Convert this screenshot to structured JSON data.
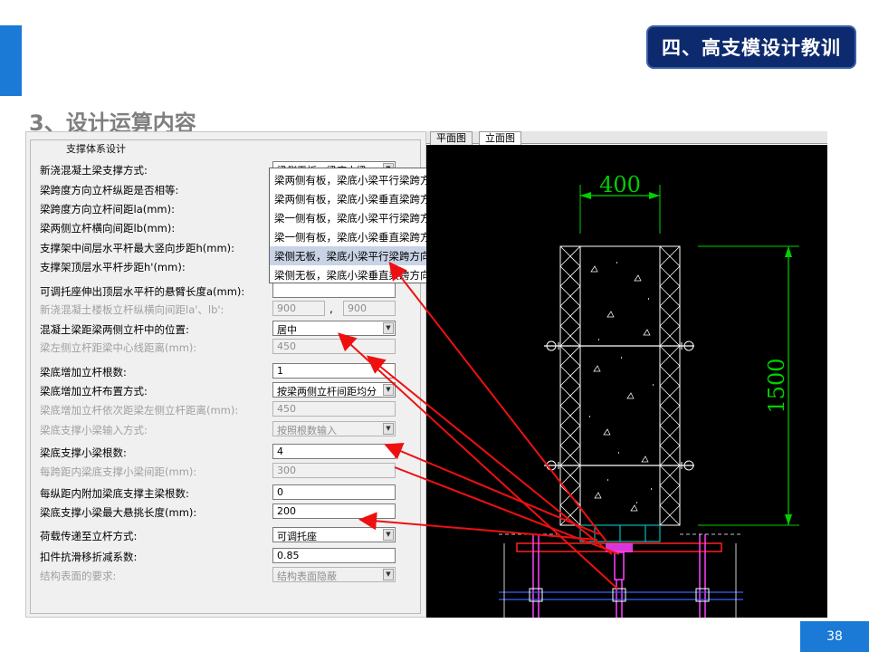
{
  "header": {
    "badge": "四、高支模设计教训"
  },
  "slide": {
    "title": "3、设计运算内容",
    "page_number": "38"
  },
  "dialog": {
    "group_title": "支撑体系设计",
    "rows": [
      {
        "label": "新浇混凝土梁支撑方式:",
        "value": "梁侧无板，梁底小梁",
        "kind": "combo"
      },
      {
        "label": "梁跨度方向立杆纵距是否相等:",
        "value": "",
        "kind": "none"
      },
      {
        "label": "梁跨度方向立杆间距la(mm):",
        "value": "",
        "kind": "none"
      },
      {
        "label": "梁两侧立杆横向间距lb(mm):",
        "value": "",
        "kind": "none"
      },
      {
        "label": "支撑架中间层水平杆最大竖向步距h(mm):",
        "value": "",
        "kind": "none"
      },
      {
        "label": "支撑架顶层水平杆步距h'(mm):",
        "value": "",
        "kind": "none"
      },
      {
        "label": "可调托座伸出顶层水平杆的悬臂长度a(mm):",
        "value": "",
        "kind": "field"
      },
      {
        "label": "新浇混凝土楼板立杆纵横向间距la'、lb':",
        "value": "900",
        "value2": "900",
        "kind": "pair",
        "disabled": true
      },
      {
        "label": "混凝土梁距梁两侧立杆中的位置:",
        "value": "居中",
        "kind": "combo"
      },
      {
        "label": "梁左侧立杆距梁中心线距离(mm):",
        "value": "450",
        "kind": "field",
        "disabled": true
      },
      {
        "label": "梁底增加立杆根数:",
        "value": "1",
        "kind": "field"
      },
      {
        "label": "梁底增加立杆布置方式:",
        "value": "按梁两侧立杆间距均分",
        "kind": "combo"
      },
      {
        "label": "梁底增加立杆依次距梁左侧立杆距离(mm):",
        "value": "450",
        "kind": "field",
        "disabled": true
      },
      {
        "label": "梁底支撑小梁输入方式:",
        "value": "按照根数输入",
        "kind": "combo",
        "disabled": true
      },
      {
        "label": "梁底支撑小梁根数:",
        "value": "4",
        "kind": "field"
      },
      {
        "label": "每跨距内梁底支撑小梁间距(mm):",
        "value": "300",
        "kind": "field",
        "disabled": true
      },
      {
        "label": "每纵距内附加梁底支撑主梁根数:",
        "value": "0",
        "kind": "field"
      },
      {
        "label": "梁底支撑小梁最大悬挑长度(mm):",
        "value": "200",
        "kind": "field"
      },
      {
        "label": "荷载传递至立杆方式:",
        "value": "可调托座",
        "kind": "combo"
      },
      {
        "label": "扣件抗滑移折减系数:",
        "value": "0.85",
        "kind": "field"
      },
      {
        "label": "结构表面的要求:",
        "value": "结构表面隐蔽",
        "kind": "combo",
        "disabled": true
      }
    ],
    "dropdown_options": [
      "梁两侧有板，梁底小梁平行梁跨方向",
      "梁两侧有板，梁底小梁垂直梁跨方向",
      "梁一侧有板，梁底小梁平行梁跨方向",
      "梁一侧有板，梁底小梁垂直梁跨方向",
      "梁侧无板，梁底小梁平行梁跨方向",
      "梁侧无板，梁底小梁垂直梁跨方向"
    ],
    "dropdown_selected_index": 4
  },
  "cad": {
    "tabs": [
      "平面图",
      "立面图"
    ],
    "active_tab": 1,
    "dim_width": "400",
    "dim_height": "1500",
    "colors": {
      "green": "#00d000",
      "red": "#ff2020",
      "magenta": "#ff40ff",
      "blue": "#3a60ff",
      "white": "#ffffff",
      "cyan": "#00e0e0"
    }
  }
}
